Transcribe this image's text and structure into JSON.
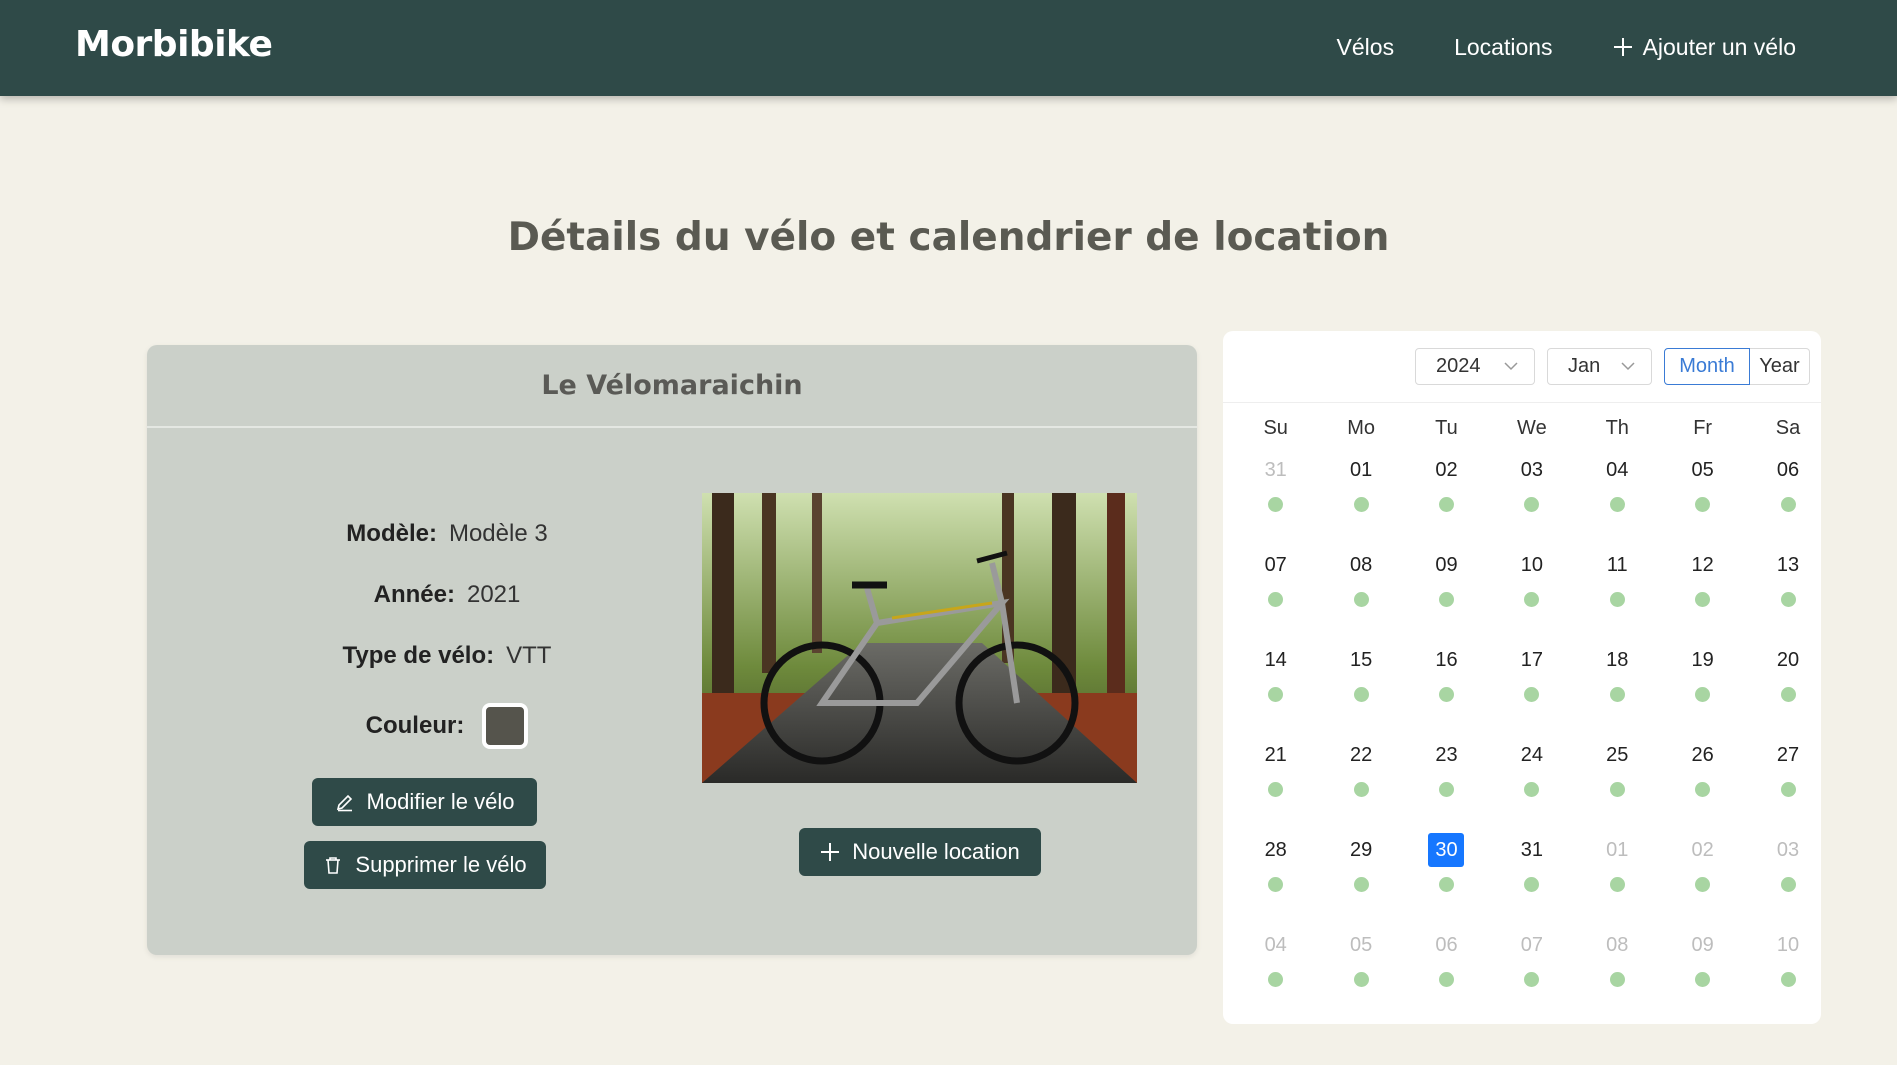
{
  "header": {
    "brand": "Morbibike",
    "nav": [
      {
        "label": "Vélos"
      },
      {
        "label": "Locations"
      },
      {
        "label": "Ajouter un vélo"
      }
    ]
  },
  "page": {
    "title": "Détails du vélo et calendrier de location"
  },
  "bike": {
    "name": "Le Vélomaraichin",
    "fields": {
      "model_label": "Modèle:",
      "model_value": "Modèle 3",
      "year_label": "Année:",
      "year_value": "2021",
      "type_label": "Type de vélo:",
      "type_value": "VTT",
      "color_label": "Couleur:",
      "color_value": "#55544c"
    },
    "buttons": {
      "edit": "Modifier le vélo",
      "delete": "Supprimer le vélo",
      "new_rental": "Nouvelle location"
    }
  },
  "calendar": {
    "year": "2024",
    "month": "Jan",
    "modes": {
      "month": "Month",
      "year": "Year",
      "active": "Month"
    },
    "weekdays": [
      "Su",
      "Mo",
      "Tu",
      "We",
      "Th",
      "Fr",
      "Sa"
    ],
    "weeks": [
      [
        "31",
        "01",
        "02",
        "03",
        "04",
        "05",
        "06"
      ],
      [
        "07",
        "08",
        "09",
        "10",
        "11",
        "12",
        "13"
      ],
      [
        "14",
        "15",
        "16",
        "17",
        "18",
        "19",
        "20"
      ],
      [
        "21",
        "22",
        "23",
        "24",
        "25",
        "26",
        "27"
      ],
      [
        "28",
        "29",
        "30",
        "31",
        "01",
        "02",
        "03"
      ],
      [
        "04",
        "05",
        "06",
        "07",
        "08",
        "09",
        "10"
      ]
    ],
    "today": "30",
    "dot_color": "#a8d5a2",
    "accent": "#1677ff"
  },
  "colors": {
    "header_bg": "#2f4a48",
    "page_bg": "#f3f1e8",
    "card_bg": "#cbd0c9",
    "button_bg": "#2f4a48"
  }
}
